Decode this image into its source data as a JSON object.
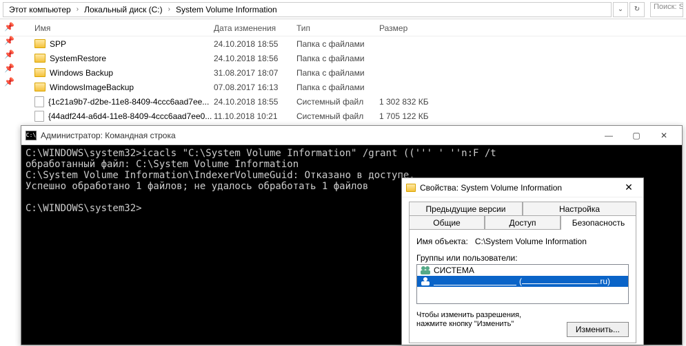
{
  "breadcrumb": {
    "items": [
      "Этот компьютер",
      "Локальный диск (C:)",
      "System Volume Information"
    ]
  },
  "search_placeholder": "Поиск: S",
  "columns": {
    "name": "Имя",
    "date": "Дата изменения",
    "type": "Тип",
    "size": "Размер"
  },
  "files": [
    {
      "name": "SPP",
      "date": "24.10.2018 18:55",
      "type": "Папка с файлами",
      "size": "",
      "kind": "folder"
    },
    {
      "name": "SystemRestore",
      "date": "24.10.2018 18:56",
      "type": "Папка с файлами",
      "size": "",
      "kind": "folder"
    },
    {
      "name": "Windows Backup",
      "date": "31.08.2017 18:07",
      "type": "Папка с файлами",
      "size": "",
      "kind": "folder"
    },
    {
      "name": "WindowsImageBackup",
      "date": "07.08.2017 16:13",
      "type": "Папка с файлами",
      "size": "",
      "kind": "folder"
    },
    {
      "name": "{1c21a9b7-d2be-11e8-8409-4ccc6aad7ee...",
      "date": "24.10.2018 18:55",
      "type": "Системный файл",
      "size": "1 302 832 КБ",
      "kind": "file"
    },
    {
      "name": "{44adf244-a6d4-11e8-8409-4ccc6aad7ee0...",
      "date": "11.10.2018 10:21",
      "type": "Системный файл",
      "size": "1 705 122 КБ",
      "kind": "file"
    }
  ],
  "cmd": {
    "title": "Администратор: Командная строка",
    "lines": [
      "C:\\WINDOWS\\system32>icacls \"C:\\System Volume Information\" /grant ((''' ' ''n:F /t",
      "обработанный файл: C:\\System Volume Information",
      "C:\\System Volume Information\\IndexerVolumeGuid: Отказано в доступе.",
      "Успешно обработано 1 файлов; не удалось обработать 1 файлов",
      "",
      "C:\\WINDOWS\\system32>"
    ]
  },
  "props": {
    "title": "Свойства: System Volume Information",
    "tabs": {
      "prev_versions": "Предыдущие версии",
      "settings": "Настройка",
      "general": "Общие",
      "access": "Доступ",
      "security": "Безопасность"
    },
    "obj_label": "Имя объекта:",
    "obj_value": "C:\\System Volume Information",
    "groups_label": "Группы или пользователи:",
    "group_system": "СИСТЕМА",
    "group_selected_suffix": ".ru)",
    "perm_note_l1": "Чтобы изменить разрешения,",
    "perm_note_l2": "нажмите кнопку \"Изменить\"",
    "change_btn": "Изменить..."
  }
}
